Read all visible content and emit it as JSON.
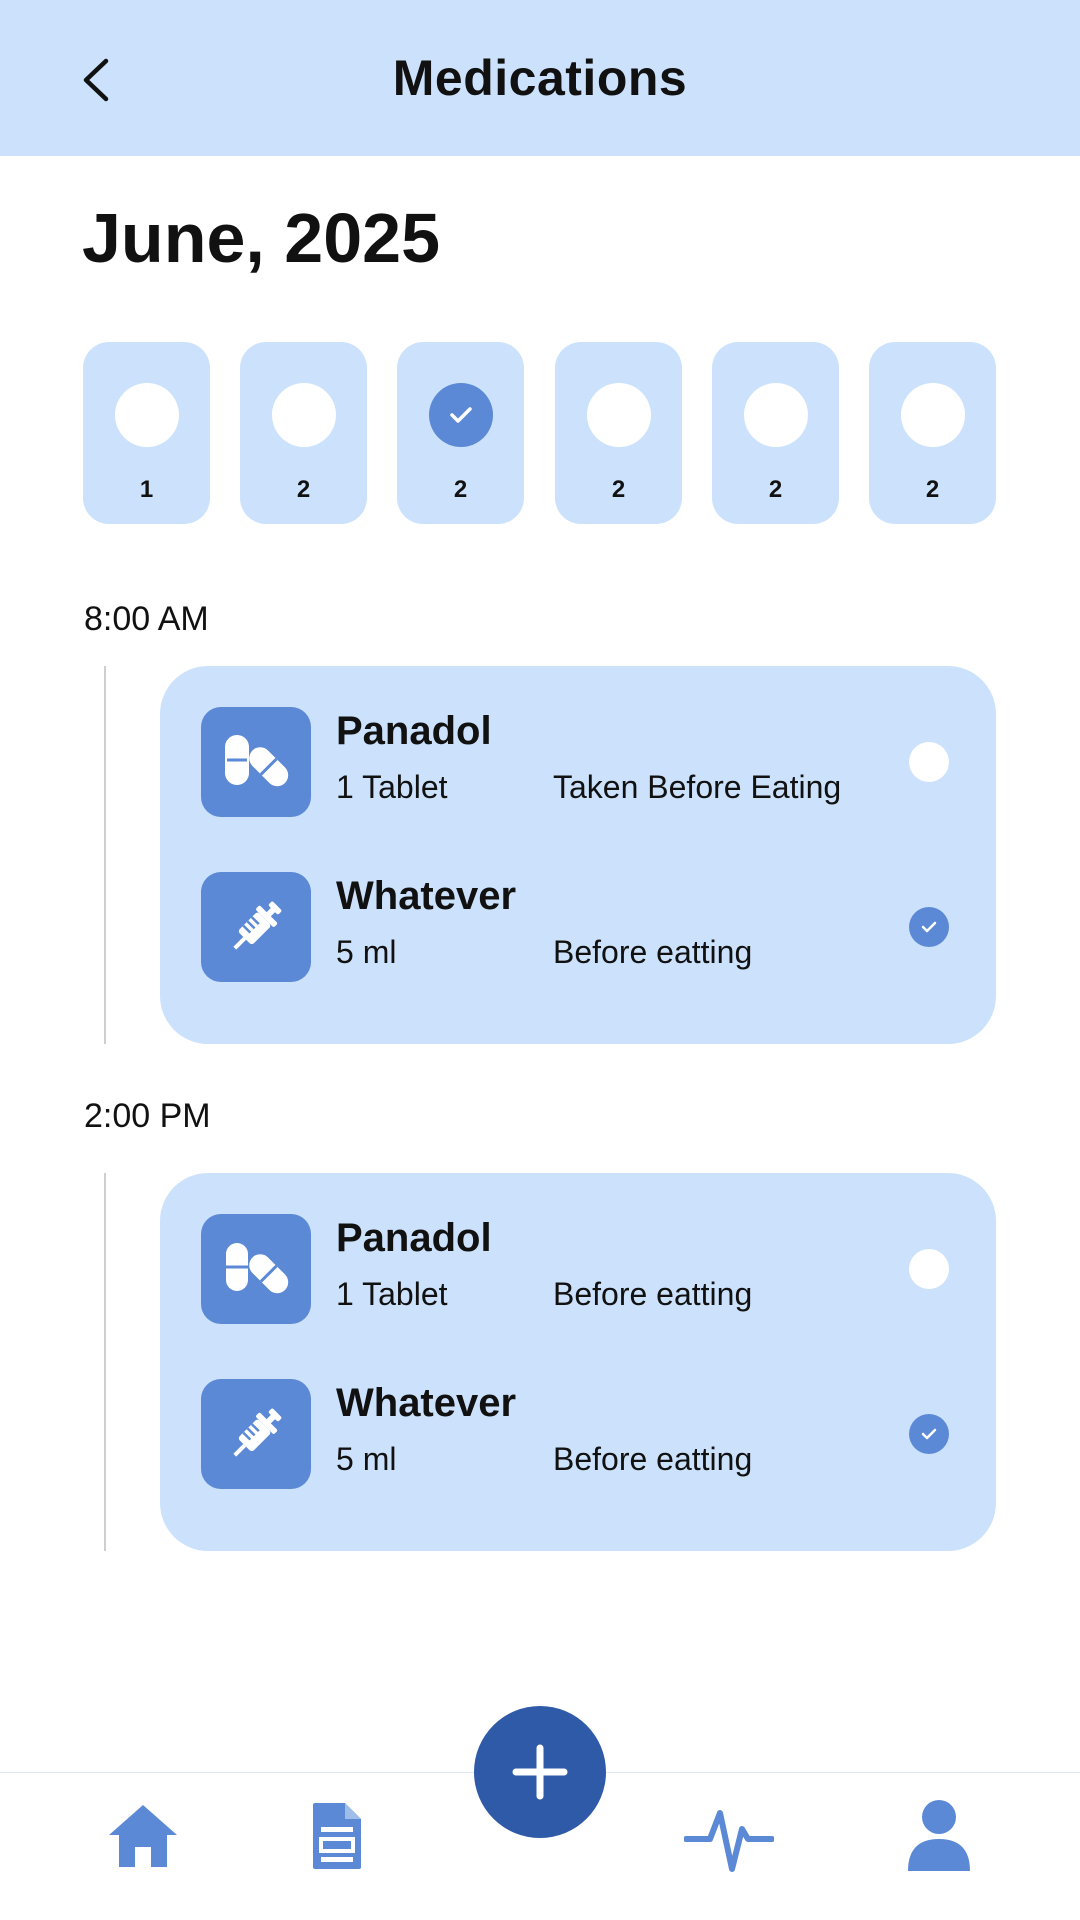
{
  "header": {
    "title": "Medications",
    "back_icon": "chevron-left-icon"
  },
  "month_label": "June, 2025",
  "days": [
    {
      "label": "1",
      "done": false
    },
    {
      "label": "2",
      "done": false
    },
    {
      "label": "2",
      "done": true
    },
    {
      "label": "2",
      "done": false
    },
    {
      "label": "2",
      "done": false
    },
    {
      "label": "2",
      "done": false
    }
  ],
  "schedule": [
    {
      "time": "8:00 AM",
      "meds": [
        {
          "icon": "pills-icon",
          "name": "Panadol",
          "dose": "1 Tablet",
          "note": "Taken Before Eating",
          "done": false
        },
        {
          "icon": "syringe-icon",
          "name": "Whatever",
          "dose": "5 ml",
          "note": "Before eatting",
          "done": true
        }
      ]
    },
    {
      "time": "2:00 PM",
      "meds": [
        {
          "icon": "pills-icon",
          "name": "Panadol",
          "dose": "1 Tablet",
          "note": "Before eatting",
          "done": false
        },
        {
          "icon": "syringe-icon",
          "name": "Whatever",
          "dose": "5 ml",
          "note": "Before eatting",
          "done": true
        }
      ]
    }
  ],
  "nav": {
    "items": [
      "home-icon",
      "document-icon",
      "heartbeat-icon",
      "profile-icon"
    ],
    "fab_icon": "plus-icon"
  },
  "colors": {
    "light_blue": "#cce2fc",
    "accent": "#5b89d6",
    "fab": "#2f5aa8"
  }
}
